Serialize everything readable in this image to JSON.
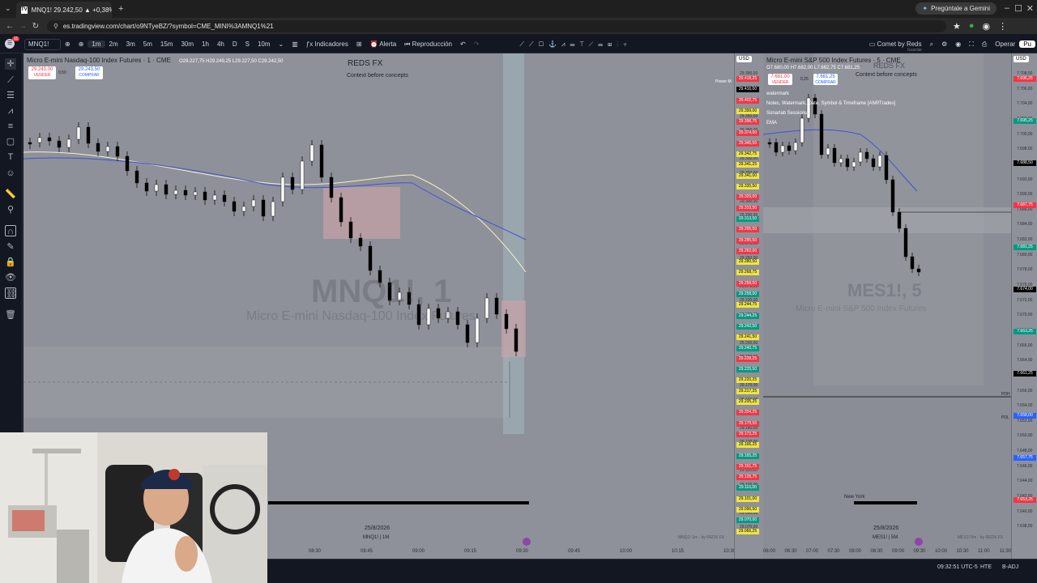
{
  "browser": {
    "tab_title": "MNQ1! 29.242,50 ▲ +0,38% C...",
    "url": "es.tradingview.com/chart/o9NTyeBZ/?symbol=CME_MINI%3AMNQ1%21",
    "gemini_label": "Pregúntale a Gemini",
    "badge_count": "11"
  },
  "toolbar": {
    "symbol": "MNQ1!",
    "intervals": [
      "1m",
      "2m",
      "3m",
      "5m",
      "15m",
      "30m",
      "1h",
      "4h",
      "D",
      "S",
      "10m"
    ],
    "selected_interval": "1m",
    "indicators_label": "Indicadores",
    "alert_label": "Alerta",
    "replay_label": "Reproducción",
    "layout_label": "Comet by Reds",
    "layout_sub": "Guardar",
    "trade_label": "Operar",
    "publish_label": "Pu"
  },
  "left_chart": {
    "title": "Micro E-mini Nasdaq-100 Index Futures · 1 · CME",
    "ohlc": "O29.227,75 H29.249,25 L29.227,50 C29.242,50",
    "sell_price": "29.243,00",
    "sell_label": "VENDER",
    "buy_price": "29.243,50",
    "buy_label": "COMPRAR",
    "spread": "0,50",
    "watermark_title": "REDS FX",
    "watermark_sub": "Context before concepts",
    "symbol_watermark": "MNQ1!, 1",
    "symbol_watermark_sub": "Micro E-mini Nasdaq-100 Index Futures",
    "date_label": "25/8/2026",
    "footer_label": "MNQ1! | 1M",
    "footer_right": "MNQ1! 1m · by REDS FX",
    "corner_label": "Power M",
    "currency": "USD",
    "time_ticks": [
      "08:30",
      "08:45",
      "09:00",
      "09:15",
      "09:30",
      "09:45",
      "10:00",
      "10:15",
      "10:30"
    ],
    "price_ticks": [
      "29.390,00",
      "29.380,00",
      "29.370,00",
      "29.360,00",
      "29.350,00",
      "29.340,00",
      "29.330,00",
      "29.320,00",
      "29.310,00",
      "29.300,00",
      "29.290,00",
      "29.280,00",
      "29.270,00",
      "29.260,00",
      "29.250,00",
      "29.240,00",
      "29.230,00",
      "29.220,00",
      "29.210,00",
      "29.200,00",
      "29.190,00",
      "29.180,00",
      "29.170,00",
      "29.160,00",
      "29.150,00",
      "29.140,00",
      "29.130,00",
      "29.120,00",
      "29.110,00",
      "29.100,00",
      "29.090,00",
      "29.080,00",
      "29.070,00"
    ],
    "price_labels": [
      {
        "text": "29.418,25",
        "color": "#f23645"
      },
      {
        "text": "29.416,00",
        "color": "#000000"
      },
      {
        "text": "29.402,75",
        "color": "#f23645"
      },
      {
        "text": "29.399,00",
        "color": "#f0e442"
      },
      {
        "text": "29.396,75",
        "color": "#f23645"
      },
      {
        "text": "29.374,00",
        "color": "#f23645"
      },
      {
        "text": "29.345,50",
        "color": "#f23645"
      },
      {
        "text": "29.342,75",
        "color": "#f0e442"
      },
      {
        "text": "29.341,25",
        "color": "#f0e442"
      },
      {
        "text": "29.341,00",
        "color": "#f0e442"
      },
      {
        "text": "29.335,50",
        "color": "#f0e442"
      },
      {
        "text": "29.329,00",
        "color": "#f23645"
      },
      {
        "text": "29.319,50",
        "color": "#f23645"
      },
      {
        "text": "29.313,50",
        "color": "#089981"
      },
      {
        "text": "29.295,50",
        "color": "#f23645"
      },
      {
        "text": "29.285,50",
        "color": "#f23645"
      },
      {
        "text": "29.282,00",
        "color": "#f23645"
      },
      {
        "text": "29.280,50",
        "color": "#f0e442"
      },
      {
        "text": "29.268,75",
        "color": "#f0e442"
      },
      {
        "text": "29.258,50",
        "color": "#f23645"
      },
      {
        "text": "29.258,00",
        "color": "#089981"
      },
      {
        "text": "29.244,75",
        "color": "#f0e442"
      },
      {
        "text": "29.244,25",
        "color": "#089981"
      },
      {
        "text": "29.242,50",
        "color": "#089981"
      },
      {
        "text": "29.241,50",
        "color": "#f0e442"
      },
      {
        "text": "29.240,75",
        "color": "#089981"
      },
      {
        "text": "29.228,25",
        "color": "#f23645"
      },
      {
        "text": "29.225,50",
        "color": "#089981"
      },
      {
        "text": "29.220,25",
        "color": "#f0e442"
      },
      {
        "text": "29.217,25",
        "color": "#f0e442"
      },
      {
        "text": "29.205,25",
        "color": "#f0e442"
      },
      {
        "text": "29.204,25",
        "color": "#f23645"
      },
      {
        "text": "29.179,50",
        "color": "#f23645"
      },
      {
        "text": "29.173,25",
        "color": "#f23645"
      },
      {
        "text": "29.166,25",
        "color": "#f0e442"
      },
      {
        "text": "29.165,25",
        "color": "#089981"
      },
      {
        "text": "29.151,75",
        "color": "#f23645"
      },
      {
        "text": "29.125,75",
        "color": "#f23645"
      },
      {
        "text": "29.116,00",
        "color": "#089981"
      },
      {
        "text": "29.101,00",
        "color": "#f0e442"
      },
      {
        "text": "29.096,50",
        "color": "#f0e442"
      },
      {
        "text": "29.070,00",
        "color": "#089981"
      },
      {
        "text": "29.066,25",
        "color": "#f0e442"
      }
    ]
  },
  "right_chart": {
    "title": "Micro E-mini S&P 500 Index Futures · 5 · CME",
    "ohlc": "O7.680,00 H7.682,00 L7.662,75 C7.681,25",
    "sell_price": "7.681,00",
    "sell_label": "VENDER",
    "buy_price": "7.681,25",
    "buy_label": "COMPRAR",
    "spread": "0,25",
    "watermark_title": "REDS FX",
    "watermark_sub": "Context before concepts",
    "symbol_watermark": "MES1!, 5",
    "symbol_watermark_sub": "Micro E-mini S&P 500 Index Futures",
    "indicators": [
      "watermark",
      "Notes, Watermark, Date, Symbol & Timeframe [ANRTrades]",
      "Sonarlab Sessions",
      "EMA"
    ],
    "session_label": "New York",
    "date_label": "25/8/2026",
    "footer_label": "MES1! | 5M",
    "footer_right": "MES1! 5m · by REDS FX",
    "currency": "USD",
    "pdh_label": "PDH",
    "pdl_label": "PDL",
    "time_ticks": [
      "06:00",
      "06:30",
      "07:00",
      "07:30",
      "08:00",
      "08:30",
      "09:00",
      "09:30",
      "10:00",
      "10:30",
      "11:00",
      "11:30"
    ],
    "price_ticks": [
      "7.708,00",
      "7.706,00",
      "7.704,00",
      "7.702,00",
      "7.700,00",
      "7.698,00",
      "7.694,00",
      "7.692,00",
      "7.690,00",
      "7.686,00",
      "7.684,00",
      "7.682,00",
      "7.680,00",
      "7.678,00",
      "7.676,00",
      "7.672,00",
      "7.670,00",
      "7.668,00",
      "7.666,00",
      "7.664,00",
      "7.660,00",
      "7.656,00",
      "7.654,00",
      "7.652,00",
      "7.650,00",
      "7.648,00",
      "7.646,00",
      "7.644,00",
      "7.642,00",
      "7.640,00",
      "7.638,00"
    ],
    "price_labels": [
      {
        "text": "7.696,25",
        "color": "#f23645"
      },
      {
        "text": "7.695,25",
        "color": "#089981"
      },
      {
        "text": "7.688,50",
        "color": "#000000"
      },
      {
        "text": "7.687,75",
        "color": "#f23645"
      },
      {
        "text": "7.681,25",
        "color": "#089981"
      },
      {
        "text": "7.674,00",
        "color": "#000000"
      },
      {
        "text": "7.663,25",
        "color": "#089981"
      },
      {
        "text": "7.661,25",
        "color": "#000000"
      },
      {
        "text": "7.658,00",
        "color": "#2962ff"
      },
      {
        "text": "7.657,75",
        "color": "#2962ff"
      },
      {
        "text": "7.653,25",
        "color": "#f23645"
      }
    ]
  },
  "status": {
    "clock": "09:32:51 UTC-5",
    "exchange": "HTE",
    "adj": "B-ADJ"
  }
}
